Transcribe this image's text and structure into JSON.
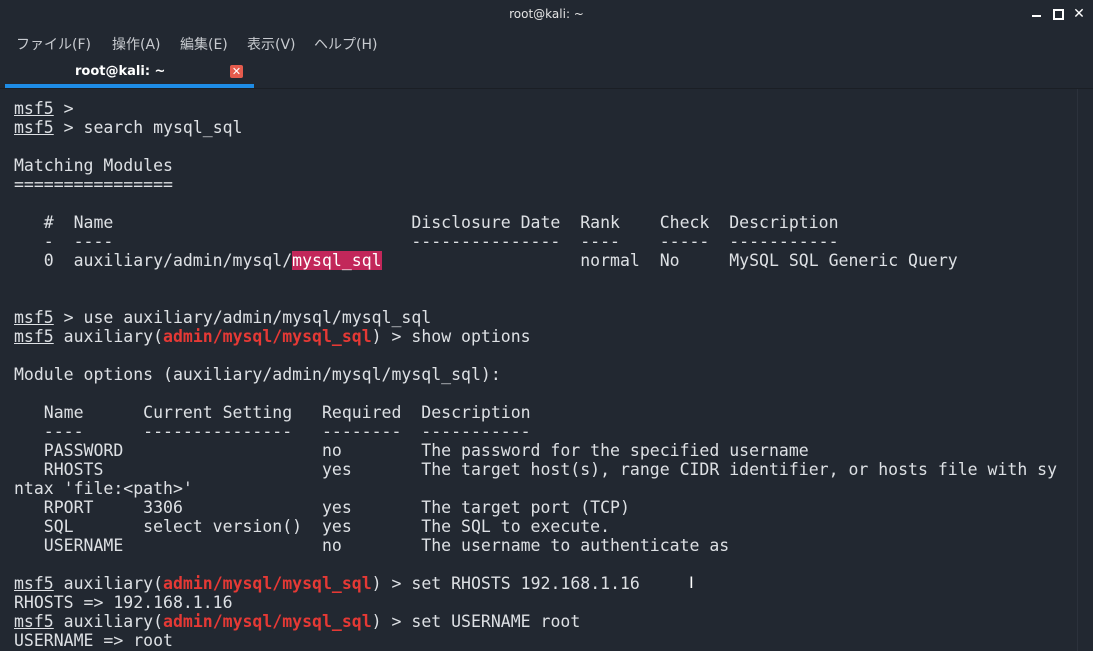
{
  "window": {
    "title": "root@kali: ~",
    "controls": {
      "minimize": "minimize",
      "maximize": "maximize",
      "close": "✕"
    }
  },
  "menu": [
    {
      "label": "ファイル(F)"
    },
    {
      "label": "操作(A)"
    },
    {
      "label": "編集(E)"
    },
    {
      "label": "表示(V)"
    },
    {
      "label": "ヘルプ(H)"
    }
  ],
  "tab": {
    "label": "root@kali: ~",
    "close": "✕"
  },
  "colors": {
    "background": "#222831",
    "accent": "#1e8ce6",
    "module_red": "#e53935",
    "highlight": "#c2275a"
  },
  "terminal": {
    "prompt": "msf5",
    "l1_rest": " >",
    "l2_rest": " > search mysql_sql",
    "l4": "Matching Modules",
    "l5": "================",
    "l7": "   #  Name                              Disclosure Date  Rank    Check  Description",
    "l8": "   -  ----                              ---------------  ----    -----  -----------",
    "l9_pre": "   0  auxiliary/admin/mysql/",
    "l9_hl": "mysql_sql",
    "l9_post": "                    normal  No     MySQL SQL Generic Query",
    "l12_rest": " > use auxiliary/admin/mysql/mysql_sql",
    "aux_open": " auxiliary(",
    "module": "admin/mysql/mysql_sql",
    "l13_close": ") > show options",
    "l15": "Module options (auxiliary/admin/mysql/mysql_sql):",
    "l17": "   Name      Current Setting   Required  Description",
    "l18": "   ----      ---------------   --------  -----------",
    "l19": "   PASSWORD                    no        The password for the specified username",
    "l20": "   RHOSTS                      yes       The target host(s), range CIDR identifier, or hosts file with sy",
    "l21": "ntax 'file:<path>'",
    "l22": "   RPORT     3306              yes       The target port (TCP)",
    "l23": "   SQL       select version()  yes       The SQL to execute.",
    "l24": "   USERNAME                    no        The username to authenticate as",
    "l26_close": ") > set RHOSTS 192.168.1.16",
    "l27": "RHOSTS => 192.168.1.16",
    "l28_close": ") > set USERNAME root",
    "l29": "USERNAME => root"
  }
}
